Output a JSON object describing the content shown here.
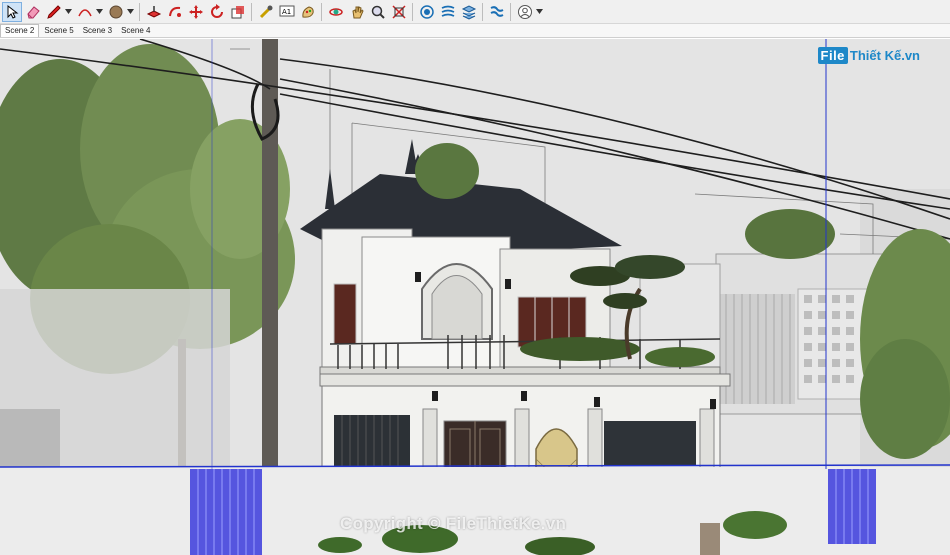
{
  "toolbar": {
    "tools": [
      {
        "name": "select-icon",
        "active": true
      },
      {
        "name": "eraser-icon",
        "active": false
      },
      {
        "name": "pencil-icon",
        "active": false,
        "dropdown": true
      },
      {
        "name": "arc-icon",
        "active": false,
        "dropdown": true
      },
      {
        "name": "paint-bucket-icon",
        "active": false,
        "dropdown": true
      },
      {
        "name": "push-pull-icon",
        "active": false
      },
      {
        "name": "follow-me-icon",
        "active": false
      },
      {
        "name": "move-icon",
        "active": false
      },
      {
        "name": "rotate-icon",
        "active": false
      },
      {
        "name": "scale-icon",
        "active": false
      },
      {
        "name": "tape-measure-icon",
        "active": false
      },
      {
        "name": "text-icon",
        "active": false
      },
      {
        "name": "paint-icon",
        "active": false
      },
      {
        "name": "orbit-icon",
        "active": false
      },
      {
        "name": "pan-icon",
        "active": false
      },
      {
        "name": "zoom-icon",
        "active": false
      },
      {
        "name": "zoom-extents-icon",
        "active": false
      },
      {
        "name": "layers-icon",
        "active": false
      },
      {
        "name": "outliner-icon",
        "active": false
      },
      {
        "name": "materials-icon",
        "active": false
      },
      {
        "name": "styles-icon",
        "active": false
      },
      {
        "name": "account-icon",
        "active": false,
        "dropdown": true
      }
    ],
    "text_tool_label": "A1"
  },
  "scenes": [
    {
      "label": "Scene 2",
      "active": true
    },
    {
      "label": "Scene 5",
      "active": false
    },
    {
      "label": "Scene 3",
      "active": false
    },
    {
      "label": "Scene 4",
      "active": false
    }
  ],
  "brand": {
    "box": "File",
    "text": "Thiết Kế.vn"
  },
  "watermark": "Copyright © FileThietKe.vn",
  "colors": {
    "sky": "#e6e6e6",
    "roof": "#2b2f36",
    "wall": "#f4f4f2",
    "fence": "#ececec",
    "accent_blue": "#2233cc",
    "brand": "#1e88c8"
  }
}
